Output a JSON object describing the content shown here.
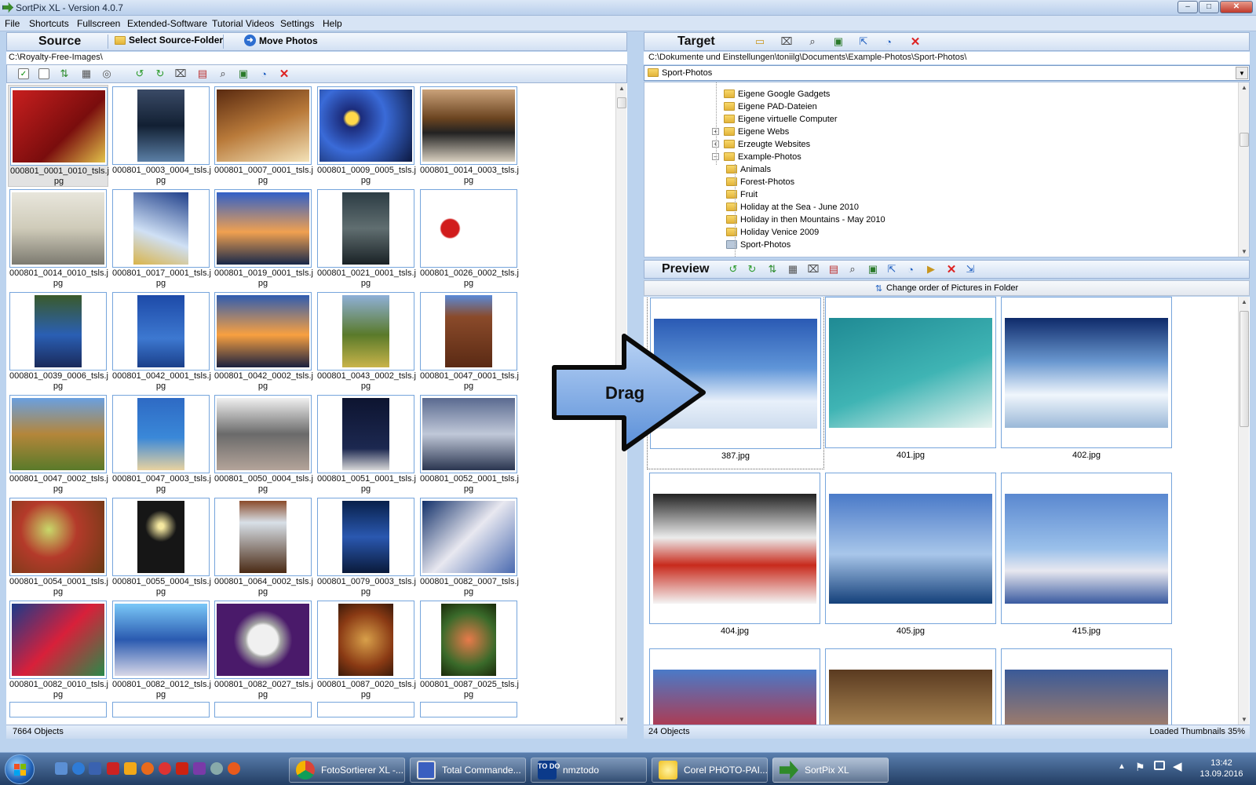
{
  "window": {
    "title": "SortPix XL - Version 4.0.7",
    "minimize": "–",
    "maximize": "□",
    "close": "✕"
  },
  "menu": [
    "File",
    "Shortcuts",
    "Fullscreen",
    "Extended-Software",
    "Tutorial Videos",
    "Settings",
    "Help"
  ],
  "source": {
    "title": "Source",
    "select_folder": "Select Source-Folder",
    "move_photos": "Move Photos",
    "path": "C:\\Royalty-Free-Images\\",
    "status": "7664 Objects",
    "thumbnails": [
      [
        "000801_0001_0010_tsls.j",
        "pg"
      ],
      [
        "000801_0003_0004_tsls.j",
        "pg"
      ],
      [
        "000801_0007_0001_tsls.j",
        "pg"
      ],
      [
        "000801_0009_0005_tsls.j",
        "pg"
      ],
      [
        "000801_0014_0003_tsls.j",
        "pg"
      ],
      [
        "000801_0014_0010_tsls.j",
        "pg"
      ],
      [
        "000801_0017_0001_tsls.j",
        "pg"
      ],
      [
        "000801_0019_0001_tsls.j",
        "pg"
      ],
      [
        "000801_0021_0001_tsls.j",
        "pg"
      ],
      [
        "000801_0026_0002_tsls.j",
        "pg"
      ],
      [
        "000801_0039_0006_tsls.j",
        "pg"
      ],
      [
        "000801_0042_0001_tsls.j",
        "pg"
      ],
      [
        "000801_0042_0002_tsls.j",
        "pg"
      ],
      [
        "000801_0043_0002_tsls.j",
        "pg"
      ],
      [
        "000801_0047_0001_tsls.j",
        "pg"
      ],
      [
        "000801_0047_0002_tsls.j",
        "pg"
      ],
      [
        "000801_0047_0003_tsls.j",
        "pg"
      ],
      [
        "000801_0050_0004_tsls.j",
        "pg"
      ],
      [
        "000801_0051_0001_tsls.j",
        "pg"
      ],
      [
        "000801_0052_0001_tsls.j",
        "pg"
      ],
      [
        "000801_0054_0001_tsls.j",
        "pg"
      ],
      [
        "000801_0055_0004_tsls.j",
        "pg"
      ],
      [
        "000801_0064_0002_tsls.j",
        "pg"
      ],
      [
        "000801_0079_0003_tsls.j",
        "pg"
      ],
      [
        "000801_0082_0007_tsls.j",
        "pg"
      ],
      [
        "000801_0082_0010_tsls.j",
        "pg"
      ],
      [
        "000801_0082_0012_tsls.j",
        "pg"
      ],
      [
        "000801_0082_0027_tsls.j",
        "pg"
      ],
      [
        "000801_0087_0020_tsls.j",
        "pg"
      ],
      [
        "000801_0087_0025_tsls.j",
        "pg"
      ]
    ]
  },
  "drag_label": "Drag",
  "target": {
    "title": "Target",
    "path": "C:\\Dokumente und Einstellungen\\toniilg\\Documents\\Example-Photos\\Sport-Photos\\",
    "combo_value": "Sport-Photos",
    "combo_arrow": "▼",
    "tree": [
      {
        "label": "Eigene Google Gadgets",
        "level": 0,
        "expander": ""
      },
      {
        "label": "Eigene PAD-Dateien",
        "level": 0,
        "expander": ""
      },
      {
        "label": "Eigene virtuelle Computer",
        "level": 0,
        "expander": ""
      },
      {
        "label": "Eigene Webs",
        "level": 0,
        "expander": "+"
      },
      {
        "label": "Erzeugte Websites",
        "level": 0,
        "expander": "+"
      },
      {
        "label": "Example-Photos",
        "level": 0,
        "expander": "–"
      },
      {
        "label": "Animals",
        "level": 1,
        "expander": ""
      },
      {
        "label": "Forest-Photos",
        "level": 1,
        "expander": ""
      },
      {
        "label": "Fruit",
        "level": 1,
        "expander": ""
      },
      {
        "label": "Holiday at the Sea - June 2010",
        "level": 1,
        "expander": ""
      },
      {
        "label": "Holiday in then Mountains - May 2010",
        "level": 1,
        "expander": ""
      },
      {
        "label": "Holiday Venice 2009",
        "level": 1,
        "expander": ""
      },
      {
        "label": "Sport-Photos",
        "level": 1,
        "expander": ""
      }
    ]
  },
  "preview": {
    "title": "Preview",
    "change_order": "Change order of Pictures in Folder",
    "status_left": "24 Objects",
    "status_right": "Loaded Thumbnails 35%",
    "photos": [
      "387.jpg",
      "401.jpg",
      "402.jpg",
      "404.jpg",
      "405.jpg",
      "415.jpg"
    ]
  },
  "taskbar": {
    "items": [
      "FotoSortierer XL -...",
      "Total Commande...",
      "nmztodo",
      "Corel PHOTO-PAI...",
      "SortPix XL"
    ],
    "todo_icon": "TO DO",
    "time": "13:42",
    "date": "13.09.2016"
  }
}
